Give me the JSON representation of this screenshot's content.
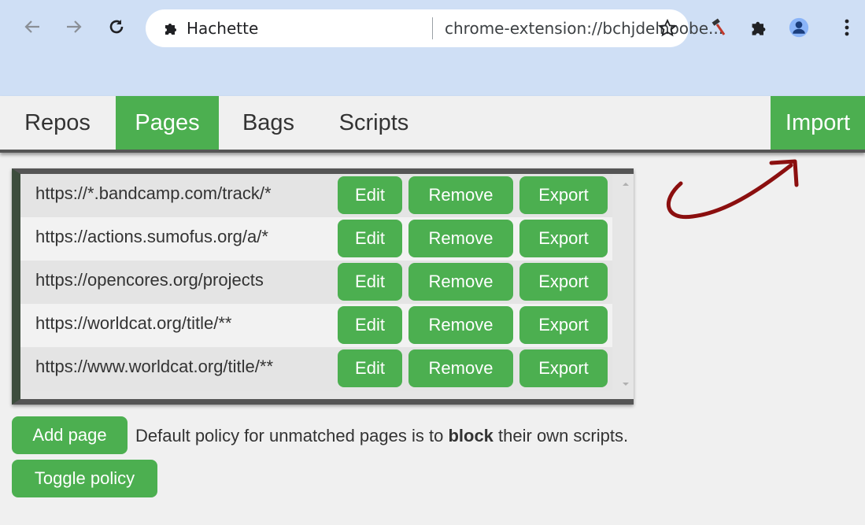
{
  "browser": {
    "tab_title": "Hachette",
    "url": "chrome-extension://bchjdelnoobe...",
    "colors": {
      "chrome_bg": "#cfdff5"
    }
  },
  "nav": {
    "tabs": [
      {
        "label": "Repos",
        "active": false
      },
      {
        "label": "Pages",
        "active": true
      },
      {
        "label": "Bags",
        "active": false
      },
      {
        "label": "Scripts",
        "active": false
      }
    ],
    "import_label": "Import"
  },
  "pages": {
    "rows": [
      {
        "url": "https://*.bandcamp.com/track/*",
        "edit": "Edit",
        "remove": "Remove",
        "export": "Export"
      },
      {
        "url": "https://actions.sumofus.org/a/*",
        "edit": "Edit",
        "remove": "Remove",
        "export": "Export"
      },
      {
        "url": "https://opencores.org/projects",
        "edit": "Edit",
        "remove": "Remove",
        "export": "Export"
      },
      {
        "url": "https://worldcat.org/title/**",
        "edit": "Edit",
        "remove": "Remove",
        "export": "Export"
      },
      {
        "url": "https://www.worldcat.org/title/**",
        "edit": "Edit",
        "remove": "Remove",
        "export": "Export"
      }
    ]
  },
  "footer": {
    "add_page_label": "Add page",
    "policy_prefix": "Default policy for unmatched pages is to ",
    "policy_value": "block",
    "policy_suffix": " their own scripts.",
    "toggle_policy_label": "Toggle policy"
  },
  "colors": {
    "accent": "#4caf50",
    "annotation_arrow": "#8b0f0f",
    "list_border_left": "#3d4d3d"
  }
}
